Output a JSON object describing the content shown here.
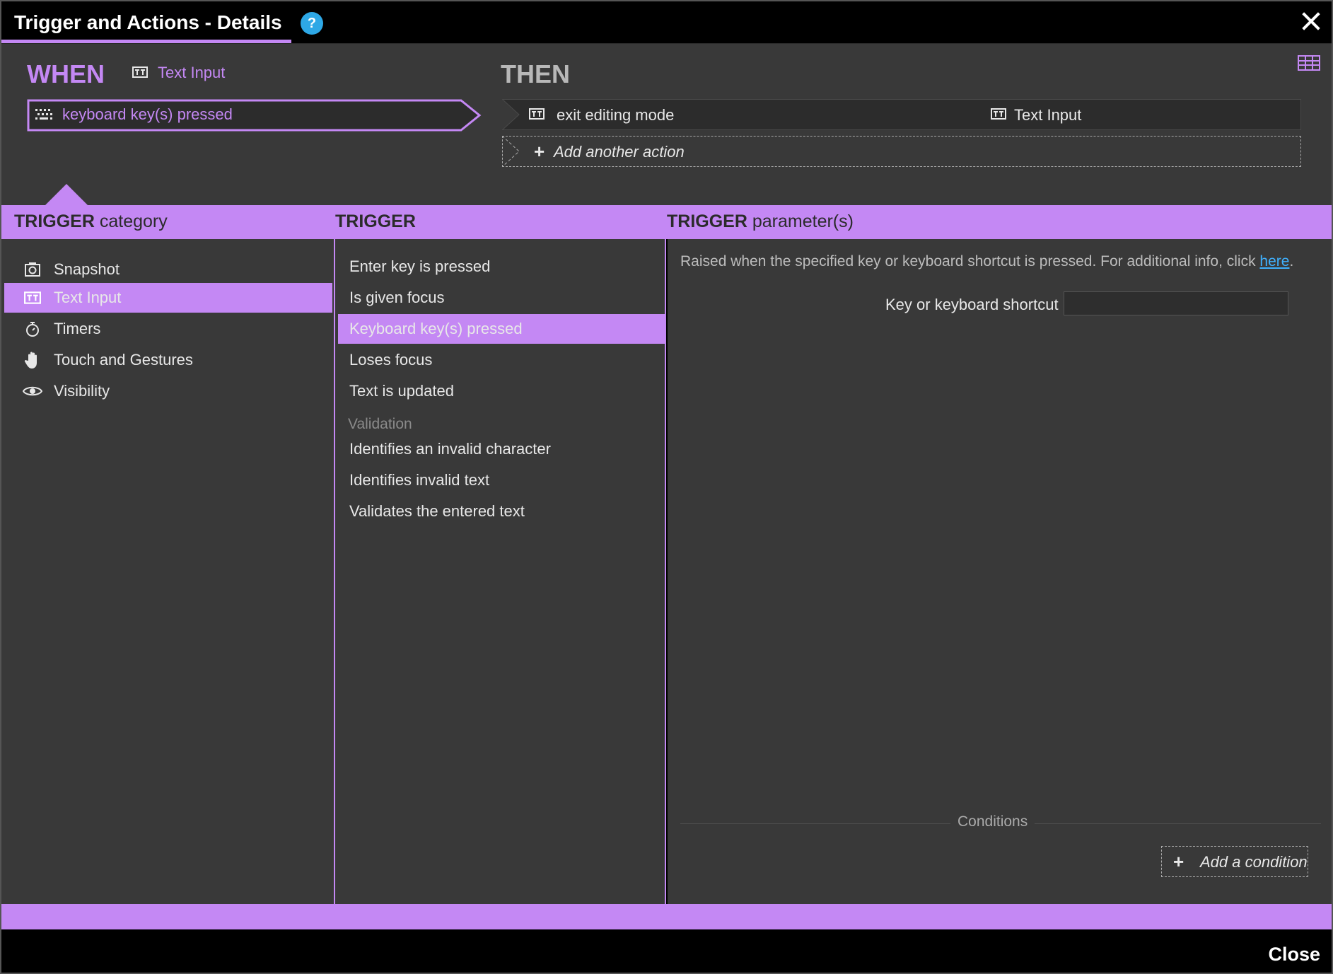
{
  "window": {
    "title": "Trigger and Actions - Details",
    "help_glyph": "?",
    "close_label": "Close",
    "accent_color": "#c488f4",
    "link_color": "#3fb1ff"
  },
  "when": {
    "label": "WHEN",
    "target": "Text Input",
    "target_icon": "text-input-icon",
    "trigger": "keyboard key(s) pressed",
    "trigger_icon": "keyboard-icon"
  },
  "then": {
    "label": "THEN",
    "actions": [
      {
        "label": "exit editing mode",
        "icon": "text-input-icon",
        "target": "Text Input",
        "target_icon": "text-input-icon"
      }
    ],
    "add_action_label": "Add another action"
  },
  "headers": {
    "category_strong": "TRIGGER",
    "category_rest": "category",
    "trigger_strong": "TRIGGER",
    "param_strong": "TRIGGER",
    "param_rest": "parameter(s)"
  },
  "categories": [
    {
      "label": "Snapshot",
      "icon": "camera-icon"
    },
    {
      "label": "Text Input",
      "icon": "text-input-icon",
      "selected": true
    },
    {
      "label": "Timers",
      "icon": "stopwatch-icon"
    },
    {
      "label": "Touch and Gestures",
      "icon": "hand-icon"
    },
    {
      "label": "Visibility",
      "icon": "eye-icon"
    }
  ],
  "triggers": [
    {
      "label": "Enter key is pressed"
    },
    {
      "label": "Is given focus"
    },
    {
      "label": "Keyboard key(s) pressed",
      "selected": true
    },
    {
      "label": "Loses focus"
    },
    {
      "label": "Text is updated"
    }
  ],
  "validation": {
    "section": "Validation",
    "items": [
      {
        "label": "Identifies an invalid character"
      },
      {
        "label": "Identifies invalid text"
      },
      {
        "label": "Validates the entered text"
      }
    ]
  },
  "params": {
    "description": "Raised when the specified key or keyboard shortcut is pressed. For additional info, click",
    "link_text": "here",
    "trailing": ".",
    "key_label": "Key or keyboard shortcut",
    "key_value": "",
    "conditions_label": "Conditions",
    "add_condition_label": "Add a condition"
  }
}
